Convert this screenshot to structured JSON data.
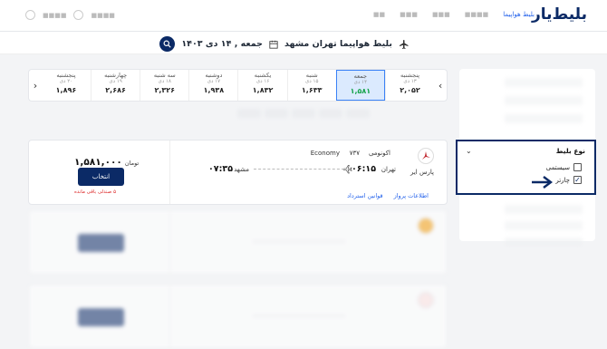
{
  "header": {
    "logo": "بلیط‌یار",
    "nav": [
      "بلیط هواپیما",
      "",
      "",
      "",
      ""
    ],
    "left": [
      "",
      ""
    ]
  },
  "search": {
    "title": "بلیط هواپیما تهران مشهد",
    "date": "جمعه , ۱۴ دی ۱۴۰۳"
  },
  "date_strip": [
    {
      "weekday": "پنجشنبه",
      "date": "۱۳ دی",
      "price": "۲,۰۵۲",
      "selected": false
    },
    {
      "weekday": "جمعه",
      "date": "۱۴ دی",
      "price": "۱,۵۸۱",
      "selected": true
    },
    {
      "weekday": "شنبه",
      "date": "۱۵ دی",
      "price": "۱,۶۳۳",
      "selected": false
    },
    {
      "weekday": "یکشنبه",
      "date": "۱۶ دی",
      "price": "۱,۸۳۲",
      "selected": false
    },
    {
      "weekday": "دوشنبه",
      "date": "۱۷ دی",
      "price": "۱,۹۳۸",
      "selected": false
    },
    {
      "weekday": "سه شنبه",
      "date": "۱۸ دی",
      "price": "۲,۳۲۶",
      "selected": false
    },
    {
      "weekday": "چهارشنبه",
      "date": "۱۹ دی",
      "price": "۲,۶۸۶",
      "selected": false
    },
    {
      "weekday": "پنجشنبه",
      "date": "۲۰ دی",
      "price": "۱,۸۹۶",
      "selected": false
    }
  ],
  "ticket_type_filter": {
    "heading": "نوع بلیط",
    "options": [
      {
        "label": "سیستمی",
        "checked": false
      },
      {
        "label": "چارتر",
        "checked": true
      }
    ],
    "check_mark": "✓"
  },
  "flight": {
    "airline": "پارس ایر",
    "class_fa": "اکونومی",
    "aircraft": "۷۳۷",
    "class_en": "Economy",
    "departure_city": "تهران",
    "departure_time": "۰۶:۱۵",
    "arrival_city": "مشهد",
    "arrival_time": "۰۷:۳۵",
    "price": "۱,۵۸۱,۰۰۰",
    "currency": "تومان",
    "select_label": "انتخاب",
    "seats_left": "۵ صندلی باقی مانده",
    "link_info": "اطلاعات پرواز",
    "link_refund": "قوانین استرداد"
  },
  "colors": {
    "primary": "#0b2a66",
    "selected_date_bg": "#dbeafe",
    "accent_link": "#2563eb",
    "warning": "#dc2626",
    "price_green": "#16a34a"
  }
}
